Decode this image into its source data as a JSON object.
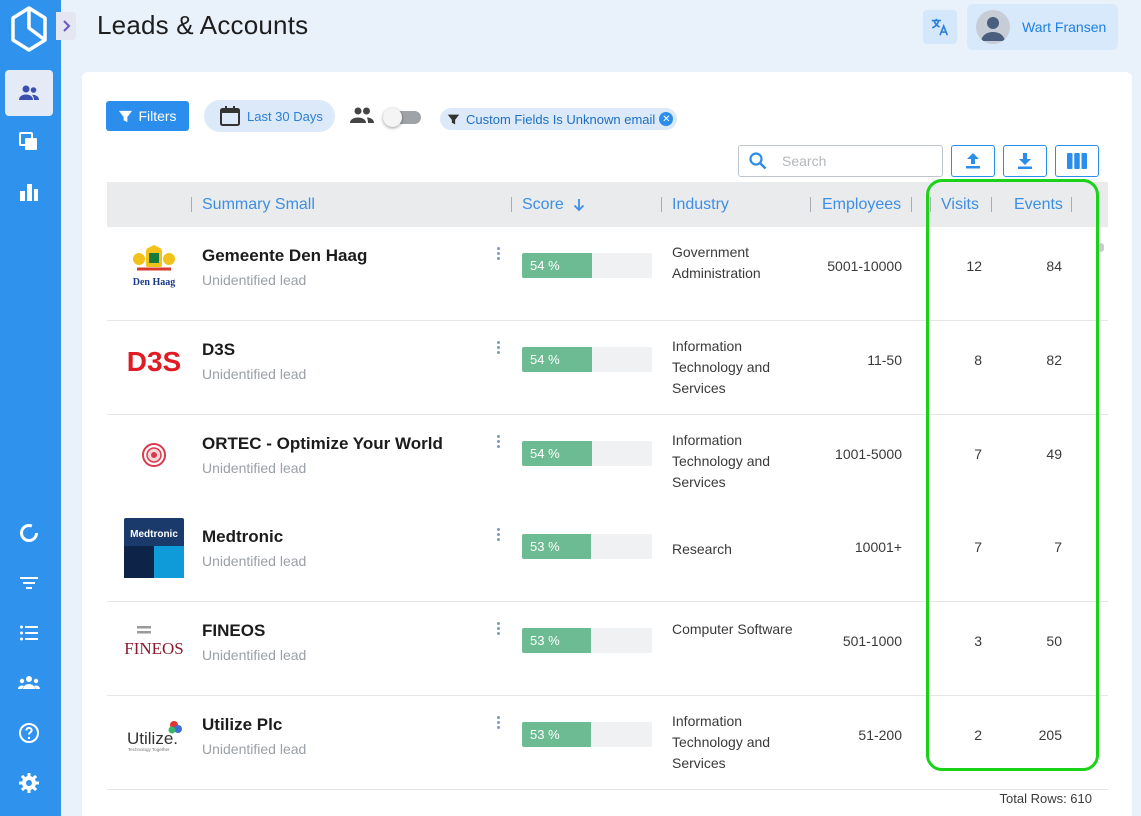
{
  "header": {
    "title": "Leads & Accounts",
    "user_name": "Wart Fransen"
  },
  "sidebar": {
    "items": [
      {
        "icon": "people-icon"
      },
      {
        "icon": "copy-icon"
      },
      {
        "icon": "bar-chart-icon"
      },
      {
        "icon": "donut-icon"
      },
      {
        "icon": "filter-lines-icon"
      },
      {
        "icon": "list-icon"
      },
      {
        "icon": "group-icon"
      },
      {
        "icon": "help-icon"
      },
      {
        "icon": "settings-icon"
      }
    ]
  },
  "toolbar": {
    "filters_label": "Filters",
    "date_range": "Last 30 Days",
    "filter_chip": "Custom Fields Is Unknown email",
    "search_placeholder": "Search"
  },
  "table": {
    "columns": {
      "summary": "Summary Small",
      "score": "Score",
      "industry": "Industry",
      "employees": "Employees",
      "visits": "Visits",
      "events": "Events"
    },
    "rows": [
      {
        "name": "Gemeente Den Haag",
        "status": "Unidentified lead",
        "score": "54 %",
        "score_pct": 54,
        "industry": "Government Administration",
        "employees": "5001-10000",
        "visits": "12",
        "events": "84",
        "logo_text": "Den Haag"
      },
      {
        "name": "D3S",
        "status": "Unidentified lead",
        "score": "54 %",
        "score_pct": 54,
        "industry": "Information Technology and Services",
        "employees": "11-50",
        "visits": "8",
        "events": "82",
        "logo_text": "D3S"
      },
      {
        "name": "ORTEC - Optimize Your World",
        "status": "Unidentified lead",
        "score": "54 %",
        "score_pct": 54,
        "industry": "Information Technology and Services",
        "employees": "1001-5000",
        "visits": "7",
        "events": "49",
        "logo_text": ""
      },
      {
        "name": "Medtronic",
        "status": "Unidentified lead",
        "score": "53 %",
        "score_pct": 53,
        "industry": "Research",
        "employees": "10001+",
        "visits": "7",
        "events": "7",
        "logo_text": "Medtronic"
      },
      {
        "name": "FINEOS",
        "status": "Unidentified lead",
        "score": "53 %",
        "score_pct": 53,
        "industry": "Computer Software",
        "employees": "501-1000",
        "visits": "3",
        "events": "50",
        "logo_text": "FINEOS"
      },
      {
        "name": "Utilize Plc",
        "status": "Unidentified lead",
        "score": "53 %",
        "score_pct": 53,
        "industry": "Information Technology and Services",
        "employees": "51-200",
        "visits": "2",
        "events": "205",
        "logo_text": "Utilize"
      }
    ],
    "total_rows": "Total Rows: 610"
  },
  "colors": {
    "sidebar": "#2f93ee",
    "accent": "#2c8eec",
    "score_fill": "#6dbb92",
    "highlight": "#19d219"
  }
}
